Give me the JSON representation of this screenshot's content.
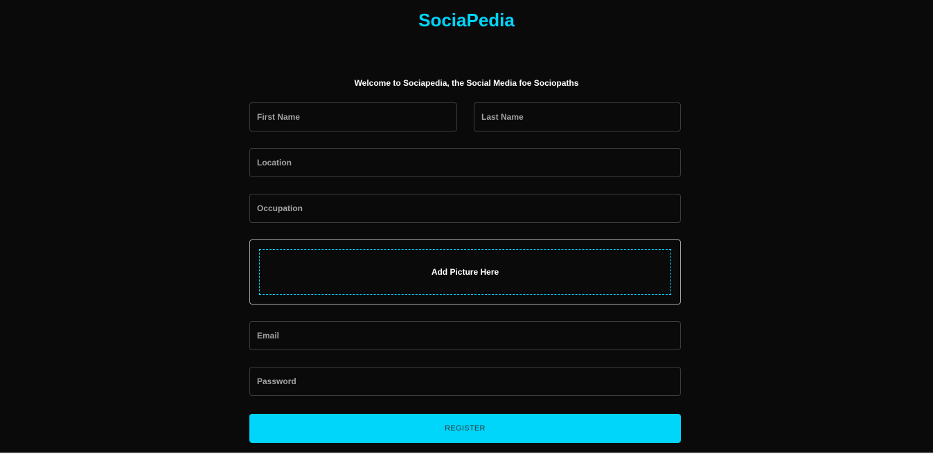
{
  "header": {
    "brand": "SociaPedia"
  },
  "form": {
    "welcome": "Welcome to Sociapedia, the Social Media foe Sociopaths",
    "first_name": {
      "placeholder": "First Name",
      "value": ""
    },
    "last_name": {
      "placeholder": "Last Name",
      "value": ""
    },
    "location": {
      "placeholder": "Location",
      "value": ""
    },
    "occupation": {
      "placeholder": "Occupation",
      "value": ""
    },
    "picture": {
      "label": "Add Picture Here"
    },
    "email": {
      "placeholder": "Email",
      "value": ""
    },
    "password": {
      "placeholder": "Password",
      "value": ""
    },
    "register_label": "REGISTER"
  },
  "colors": {
    "accent": "#00d5fa",
    "background": "#0a0a0a",
    "field_border": "#3d3d3d",
    "placeholder": "#a3a3a3"
  }
}
